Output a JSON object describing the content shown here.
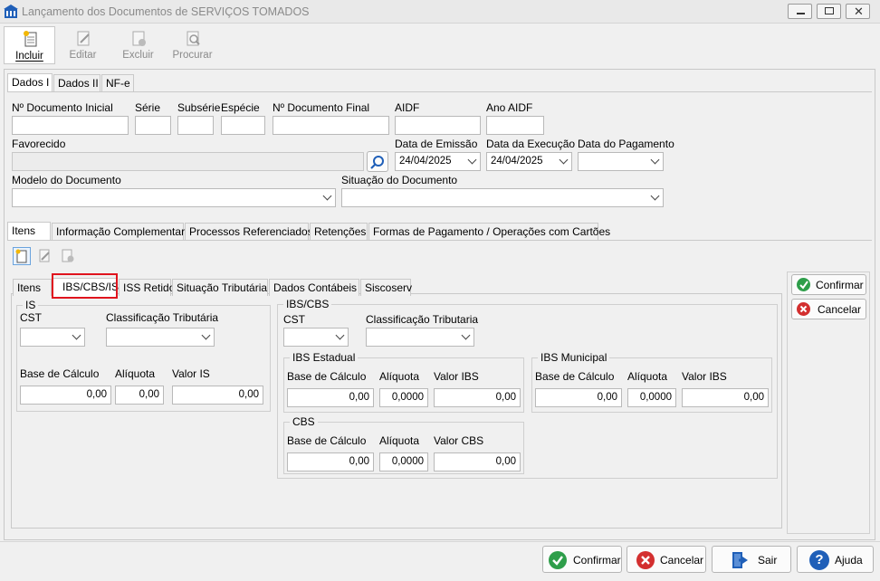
{
  "window": {
    "title": "Lançamento dos Documentos de SERVIÇOS TOMADOS"
  },
  "toolbar": {
    "incluir": "Incluir",
    "editar": "Editar",
    "excluir": "Excluir",
    "procurar": "Procurar"
  },
  "top_tabs": [
    "Dados I",
    "Dados II",
    "NF-e"
  ],
  "header": {
    "doc_inicial_label": "Nº Documento Inicial",
    "serie_label": "Série",
    "subserie_label": "Subsérie",
    "especie_label": "Espécie",
    "doc_final_label": "Nº Documento Final",
    "aidf_label": "AIDF",
    "ano_aidf_label": "Ano AIDF",
    "favorecido_label": "Favorecido",
    "data_emissao_label": "Data de Emissão",
    "data_emissao_value": "24/04/2025",
    "data_execucao_label": "Data da Execução",
    "data_execucao_value": "24/04/2025",
    "data_pagamento_label": "Data do Pagamento",
    "modelo_label": "Modelo do Documento",
    "situacao_label": "Situação do Documento"
  },
  "mid_tabs": [
    "Itens",
    "Informação Complementar",
    "Processos Referenciados",
    "Retenções",
    "Formas de Pagamento / Operações com Cartões"
  ],
  "inner_tabs": [
    "Itens",
    "IBS/CBS/IS",
    "ISS Retido",
    "Situação Tributária",
    "Dados Contábeis",
    "Siscoserv"
  ],
  "is_group": {
    "title": "IS",
    "cst_label": "CST",
    "class_label": "Classificação Tributária",
    "base_label": "Base de Cálculo",
    "aliq_label": "Alíquota",
    "valor_label": "Valor IS",
    "base_value": "0,00",
    "aliq_value": "0,00",
    "valor_value": "0,00"
  },
  "ibscbs_group": {
    "title": "IBS/CBS",
    "cst_label": "CST",
    "class_label": "Classificação Tributaria"
  },
  "ibs_estadual": {
    "title": "IBS Estadual",
    "base_label": "Base de Cálculo",
    "aliq_label": "Alíquota",
    "valor_label": "Valor IBS",
    "base_value": "0,00",
    "aliq_value": "0,0000",
    "valor_value": "0,00"
  },
  "ibs_municipal": {
    "title": "IBS Municipal",
    "base_label": "Base de Cálculo",
    "aliq_label": "Alíquota",
    "valor_label": "Valor IBS",
    "base_value": "0,00",
    "aliq_value": "0,0000",
    "valor_value": "0,00"
  },
  "cbs": {
    "title": "CBS",
    "base_label": "Base de Cálculo",
    "aliq_label": "Alíquota",
    "valor_label": "Valor CBS",
    "base_value": "0,00",
    "aliq_value": "0,0000",
    "valor_value": "0,00"
  },
  "side_buttons": {
    "confirmar": "Confirmar",
    "cancelar": "Cancelar"
  },
  "bottom_buttons": {
    "confirmar": "Confirmar",
    "cancelar": "Cancelar",
    "sair": "Sair",
    "ajuda": "Ajuda"
  },
  "colors": {
    "highlight_red": "#e0141e",
    "confirm_green": "#2e9e4a",
    "cancel_red": "#d32f2f",
    "help_blue": "#1f5fb8"
  }
}
